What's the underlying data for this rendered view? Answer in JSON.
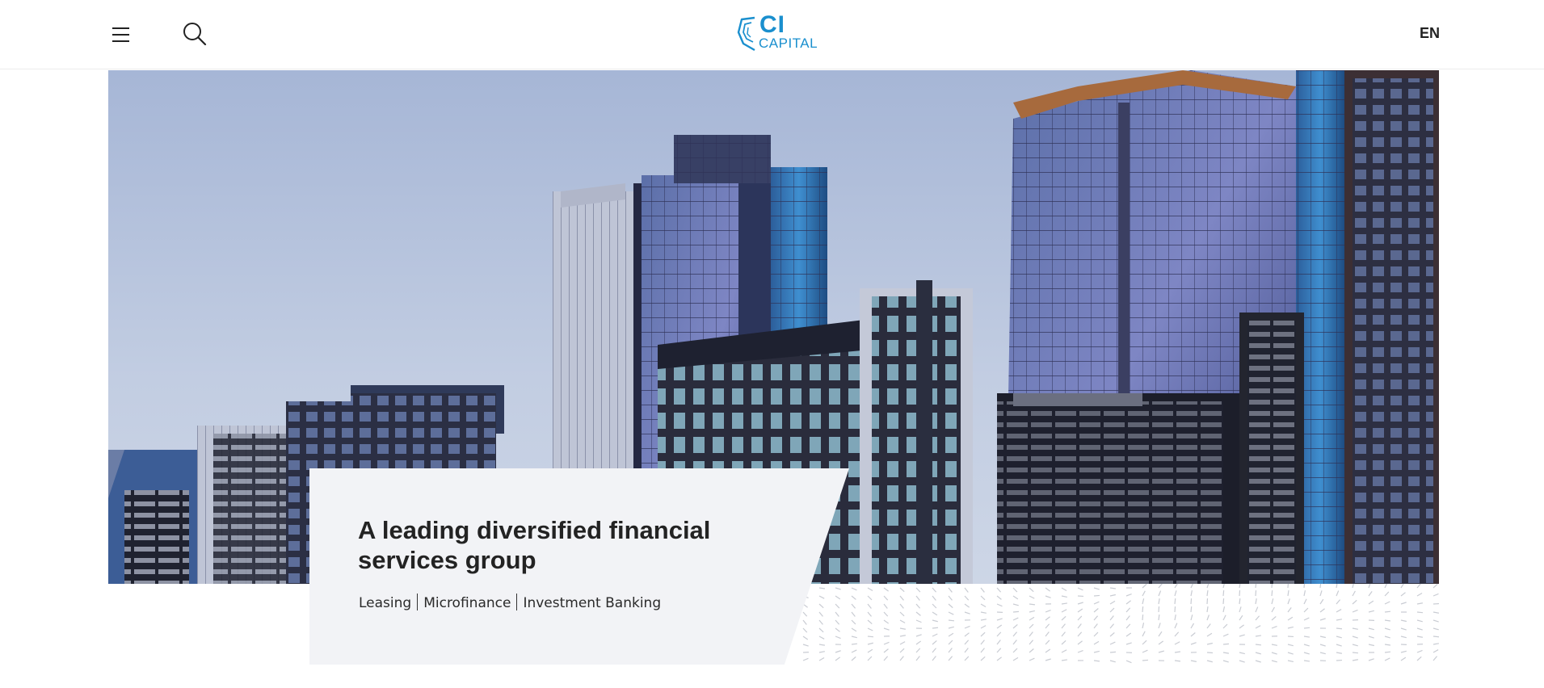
{
  "header": {
    "menu_icon": "hamburger-menu-icon",
    "search_icon": "search-icon",
    "logo": {
      "line1": "CI",
      "line2": "CAPITAL",
      "color": "#1a8fce"
    },
    "language": "EN"
  },
  "hero": {
    "title": "A leading diversified financial services group",
    "services": [
      "Leasing",
      "Microfinance",
      "Investment Banking"
    ]
  },
  "colors": {
    "brand": "#1a8fce",
    "card_background": "#f2f3f6",
    "text": "#232323"
  }
}
